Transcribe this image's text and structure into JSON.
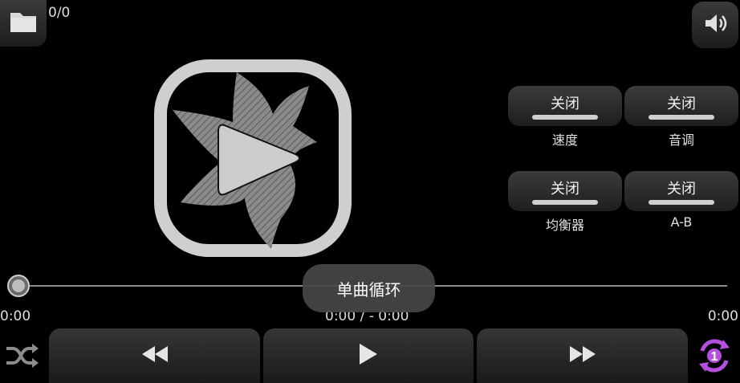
{
  "header": {
    "track_counter": "0/0"
  },
  "toggles": [
    {
      "state": "关闭",
      "caption": "速度"
    },
    {
      "state": "关闭",
      "caption": "音调"
    },
    {
      "state": "关闭",
      "caption": "均衡器"
    },
    {
      "state": "关闭",
      "caption": "A-B"
    }
  ],
  "seek": {
    "elapsed": "0:00",
    "duration": "0:00",
    "center_time": "0:00 / - 0:00",
    "progress": 0
  },
  "toast": {
    "text": "单曲循环"
  },
  "icons": {
    "folder": "folder-icon",
    "volume": "volume-icon",
    "shuffle": "shuffle-icon",
    "prev": "rewind-icon",
    "play": "play-icon",
    "next": "fast-forward-icon",
    "repeat": "repeat-one-icon"
  },
  "colors": {
    "background": "#000000",
    "accent_repeat": "#b44fe0",
    "artwork_gray": "#cccccc"
  }
}
